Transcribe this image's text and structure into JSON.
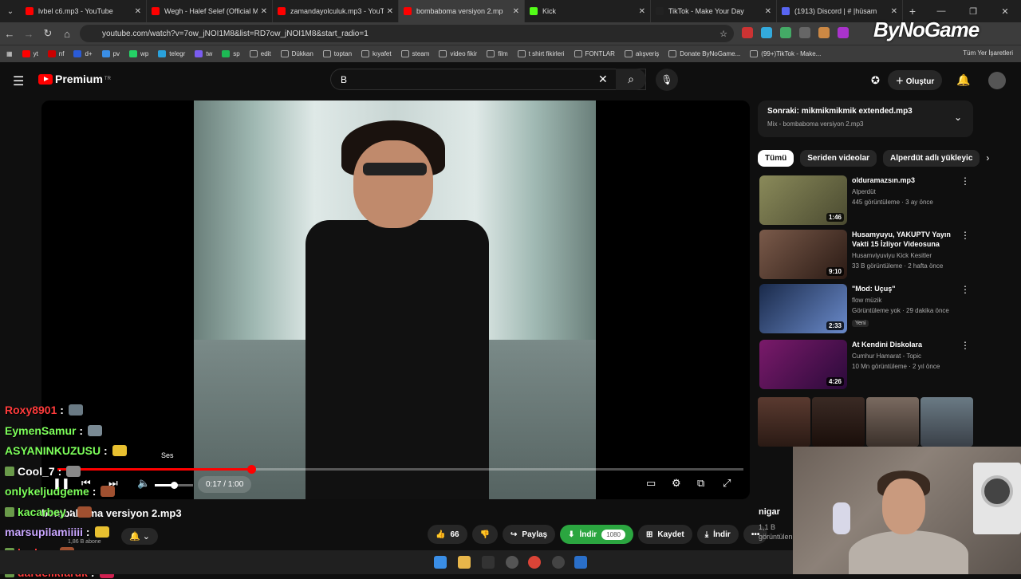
{
  "browser": {
    "tabs": [
      {
        "title": "lvbel c6.mp3 - YouTube",
        "color": "#ff0000",
        "active": false
      },
      {
        "title": "Wegh - Halef Selef (Official Mu",
        "color": "#ff0000",
        "active": false
      },
      {
        "title": "zamandayolculuk.mp3 - YouTu",
        "color": "#ff0000",
        "active": false
      },
      {
        "title": "bombaboma versiyon 2.mp",
        "color": "#ff0000",
        "active": true
      },
      {
        "title": "Kick",
        "color": "#53fc18",
        "active": false
      },
      {
        "title": "TikTok - Make Your Day",
        "color": "#222222",
        "active": false
      },
      {
        "title": "(1913) Discord | #⁠ ⁠|hüsam",
        "color": "#5865f2",
        "active": false
      }
    ],
    "url": "youtube.com/watch?v=7ow_jNOI1M8&list=RD7ow_jNOI1M8&start_radio=1",
    "overlay_logo": "ByNoGame",
    "bookmarks": [
      "yt",
      "nf",
      "d+",
      "pv",
      "wp",
      "telegr",
      "tw",
      "sp",
      "edit",
      "Dükkan",
      "toptan",
      "kıyafet",
      "steam",
      "video fikir",
      "film",
      "t shirt fikirleri",
      "FONTLAR",
      "alışveriş",
      "Donate ByNoGame...",
      "(99+)TikTok - Make..."
    ],
    "bookmarks_right": "Tüm Yer İşaretleri"
  },
  "youtube": {
    "logo_text": "Premium",
    "logo_region": "TR",
    "search_value": "B",
    "create_label": "Oluştur"
  },
  "player": {
    "tooltip": "Ses",
    "time": "0:17 / 1:00",
    "progress_fraction": 0.283,
    "volume_fraction": 0.5
  },
  "video": {
    "title": "bombaboma versiyon 2.mp3",
    "subscribers": "1,86 B abone",
    "likes": "66",
    "share_label": "Paylaş",
    "download_label": "İndir",
    "quality": "1080",
    "save_label": "Kaydet",
    "download2_label": "İndir"
  },
  "sidebar": {
    "next_title": "Sonraki: mikmikmikmik extended.mp3",
    "next_sub": "Mix - bombaboma versiyon 2.mp3",
    "chips": [
      "Tümü",
      "Seriden videolar",
      "Alperdüt adlı yükleyic"
    ],
    "recs": [
      {
        "title": "olduramazsın.mp3",
        "channel": "Alperdüt",
        "meta": "445 görüntüleme · 3 ay önce",
        "duration": "1:46",
        "new": ""
      },
      {
        "title": "Husamyuyu, YAKUPTV Yayın Vakti 15 İzliyor Videosuna Tep...",
        "channel": "Husamviyuviyu Kick Kesitler",
        "meta": "33 B görüntüleme · 2 hafta önce",
        "duration": "9:10",
        "new": ""
      },
      {
        "title": "\"Mod: Uçuş\"",
        "channel": "flow müzik",
        "meta": "Görüntüleme yok · 29 dakika önce",
        "duration": "2:33",
        "new": "Yeni"
      },
      {
        "title": "At Kendini Diskolara",
        "channel": "Cumhur Hamarat - Topic",
        "meta": "10 Mn görüntüleme · 2 yıl önce",
        "duration": "4:26",
        "new": ""
      }
    ],
    "partial_title": "nigar",
    "partial_meta1": "1,1 B",
    "partial_meta2": "görüntülen"
  },
  "chat": [
    {
      "user": "Roxy8901",
      "color": "#ff3b3b"
    },
    {
      "user": "EymenSamur",
      "color": "#7dff5a"
    },
    {
      "user": "ASYANINKUZUSU",
      "color": "#7dff5a"
    },
    {
      "user": "Cool_7",
      "color": "#ffffff"
    },
    {
      "user": "onlykeljudgeme",
      "color": "#7dff5a"
    },
    {
      "user": "kacarbey",
      "color": "#7dff5a"
    },
    {
      "user": "marsupilamiiiii",
      "color": "#c9a6ff"
    },
    {
      "user": "bcdrc",
      "color": "#ff3b3b"
    },
    {
      "user": "dardelikfaruk",
      "color": "#ff3b3b"
    }
  ]
}
